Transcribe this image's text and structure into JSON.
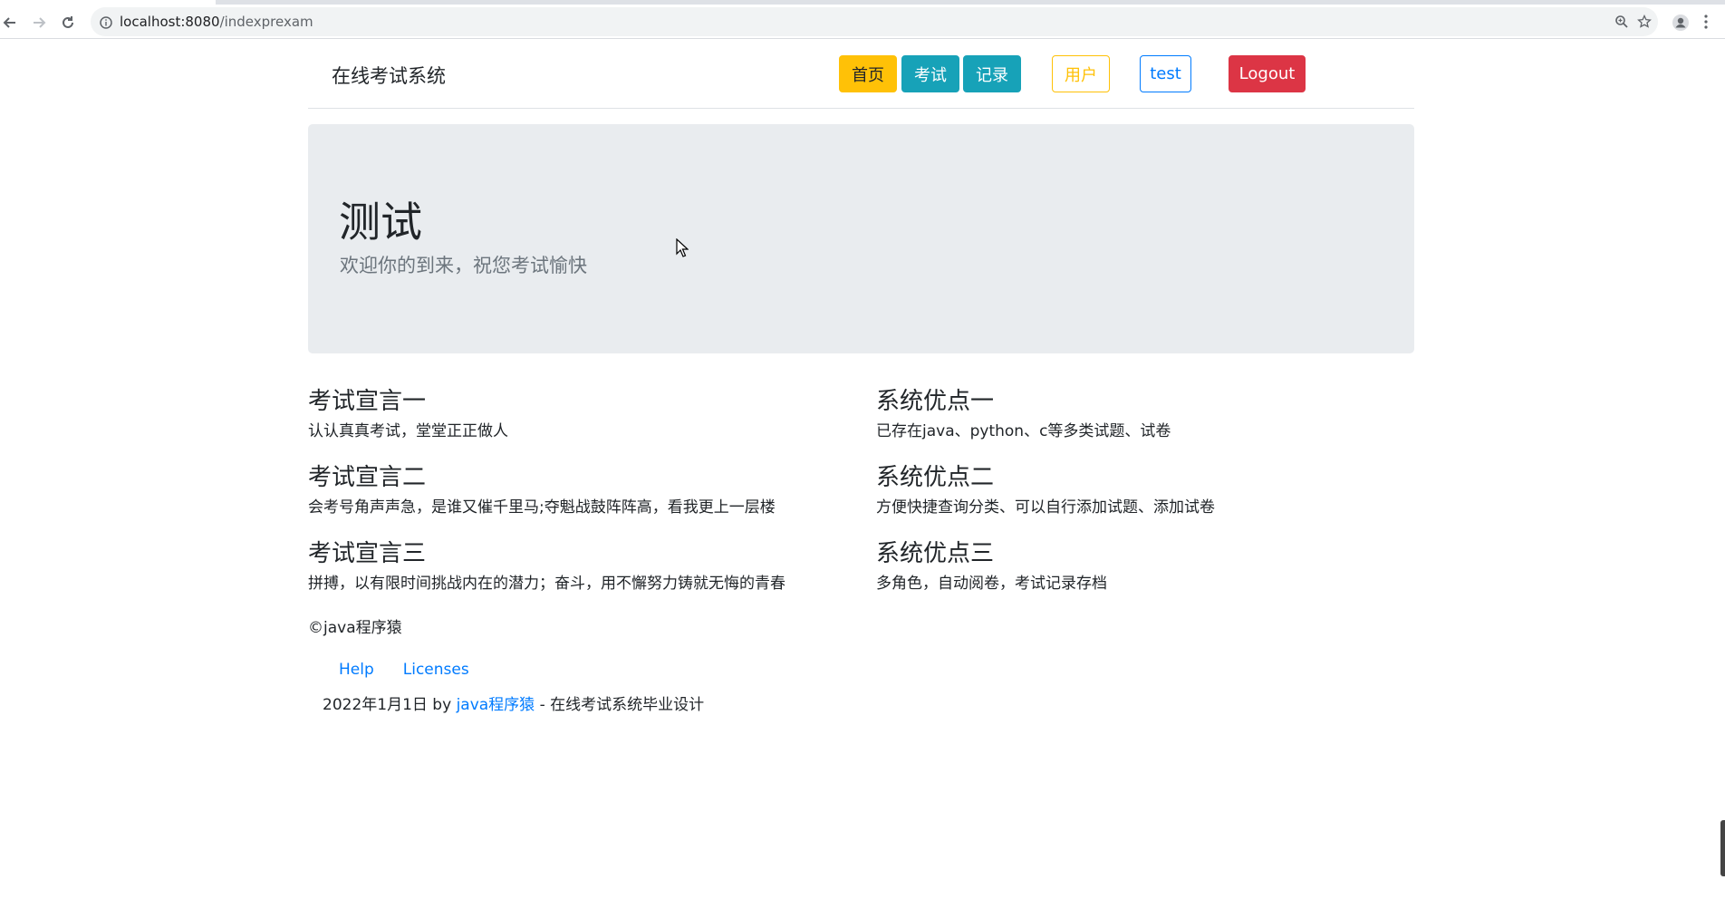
{
  "browser": {
    "url_host": "localhost:8080",
    "url_path": "/indexprexam"
  },
  "navbar": {
    "brand": "在线考试系统",
    "buttons": {
      "home": "首页",
      "exam": "考试",
      "records": "记录",
      "user": "用户",
      "test": "test",
      "logout": "Logout"
    }
  },
  "jumbotron": {
    "title": "测试",
    "subtitle": "欢迎你的到来，祝您考试愉快"
  },
  "declarations": [
    {
      "heading": "考试宣言一",
      "text": "认认真真考试，堂堂正正做人"
    },
    {
      "heading": "考试宣言二",
      "text": "会考号角声声急，是谁又催千里马;夺魁战鼓阵阵高，看我更上一层楼"
    },
    {
      "heading": "考试宣言三",
      "text": "拼搏，以有限时间挑战内在的潜力；奋斗，用不懈努力铸就无悔的青春"
    }
  ],
  "advantages": [
    {
      "heading": "系统优点一",
      "text": "已存在java、python、c等多类试题、试卷"
    },
    {
      "heading": "系统优点二",
      "text": "方便快捷查询分类、可以自行添加试题、添加试卷"
    },
    {
      "heading": "系统优点三",
      "text": "多角色，自动阅卷，考试记录存档"
    }
  ],
  "footer": {
    "copyright": "©java程序猿",
    "links": {
      "help": "Help",
      "licenses": "Licenses"
    },
    "credit_prefix": "2022年1月1日 by ",
    "credit_author": "java程序猿",
    "credit_suffix": " - 在线考试系统毕业设计"
  },
  "colors": {
    "warning": "#ffc107",
    "info": "#17a2b8",
    "primary": "#007bff",
    "danger": "#dc3545",
    "jumbotron_bg": "#e9ecef"
  }
}
